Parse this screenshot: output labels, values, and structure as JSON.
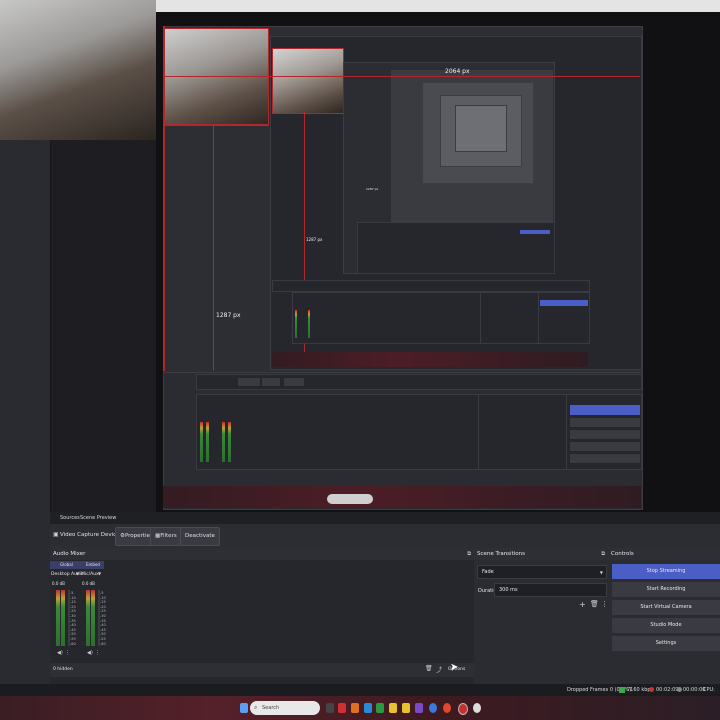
{
  "preview": {
    "measure_width": "2064 px",
    "measure_height_a": "1287 px",
    "measure_height_b": "1287 px",
    "measure_height_c": "1287 px"
  },
  "source_toolbar": {
    "header_left": "Sources",
    "header_right": "Scene Preview",
    "source_name": "Video Capture Device",
    "properties_label": "Properties",
    "filters_label": "Filters",
    "deactivate_label": "Deactivate"
  },
  "audio_mixer": {
    "title": "Audio Mixer",
    "tab_global": "Global",
    "tab_embed": "Embed",
    "channel_1": "Desktop Audio",
    "channel_2": "Mic/Aux",
    "db_1": "0.0 dB",
    "db_2": "0.0 dB",
    "scale": [
      "-5",
      "-10",
      "-15",
      "-20",
      "-25",
      "-30",
      "-35",
      "-40",
      "-45",
      "-50",
      "-55",
      "-60"
    ],
    "hidden_label": "0 hidden",
    "options_label": "Options"
  },
  "scene_transitions": {
    "title": "Scene Transitions",
    "transition": "Fade",
    "duration_label": "Duration",
    "duration_value": "300 ms"
  },
  "controls": {
    "title": "Controls",
    "stop_streaming": "Stop Streaming",
    "start_recording": "Start Recording",
    "start_virtual_camera": "Start Virtual Camera",
    "studio_mode": "Studio Mode",
    "settings": "Settings"
  },
  "status_bar": {
    "dropped_frames": "Dropped Frames 0 (0.0%)",
    "bitrate": "7160 kbps",
    "live_time": "00:02:09",
    "rec_time": "00:00:00",
    "cpu": "CPU: 1.6%"
  },
  "taskbar": {
    "search_label": "Search"
  },
  "colors": {
    "accent": "#4a5ec6",
    "live_indicator": "#b3262b",
    "background": "#1e1e22"
  }
}
